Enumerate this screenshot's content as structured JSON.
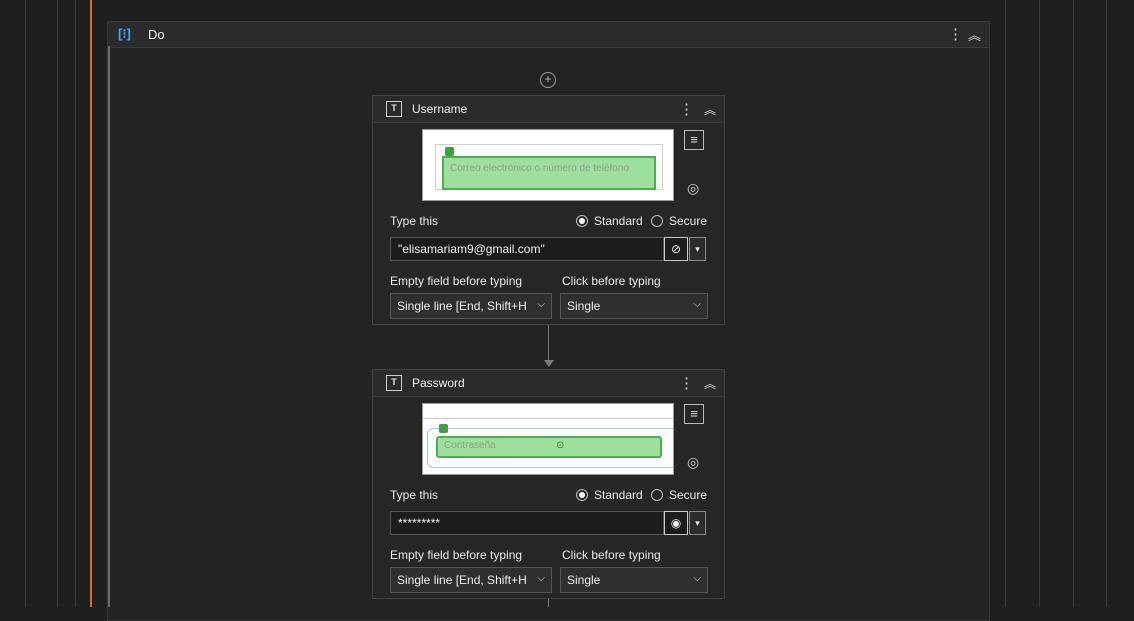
{
  "sequence": {
    "title": "Do",
    "kebab": "⋮",
    "collapse": "⌃",
    "add_symbol": "+"
  },
  "actions": [
    {
      "title": "Username",
      "preview_text": "Correo electrónico o número de teléfono",
      "type_label": "Type this",
      "radio_standard": "Standard",
      "radio_secure": "Secure",
      "selected_mode": "Standard",
      "value": "\"elisamariam9@gmail.com\"",
      "empty_label": "Empty field before typing",
      "empty_value": "Single line [End, Shift+H",
      "click_label": "Click before typing",
      "click_value": "Single",
      "eye_state": "hidden-icon"
    },
    {
      "title": "Password",
      "preview_text": "Contraseña",
      "type_label": "Type this",
      "radio_standard": "Standard",
      "radio_secure": "Secure",
      "selected_mode": "Standard",
      "value": "*********",
      "empty_label": "Empty field before typing",
      "empty_value": "Single line [End, Shift+H",
      "click_label": "Click before typing",
      "click_value": "Single",
      "eye_state": "eye-icon"
    }
  ],
  "colors": {
    "accent": "#e0661c",
    "highlight": "#9edf9e",
    "background": "#1f1f1f"
  }
}
